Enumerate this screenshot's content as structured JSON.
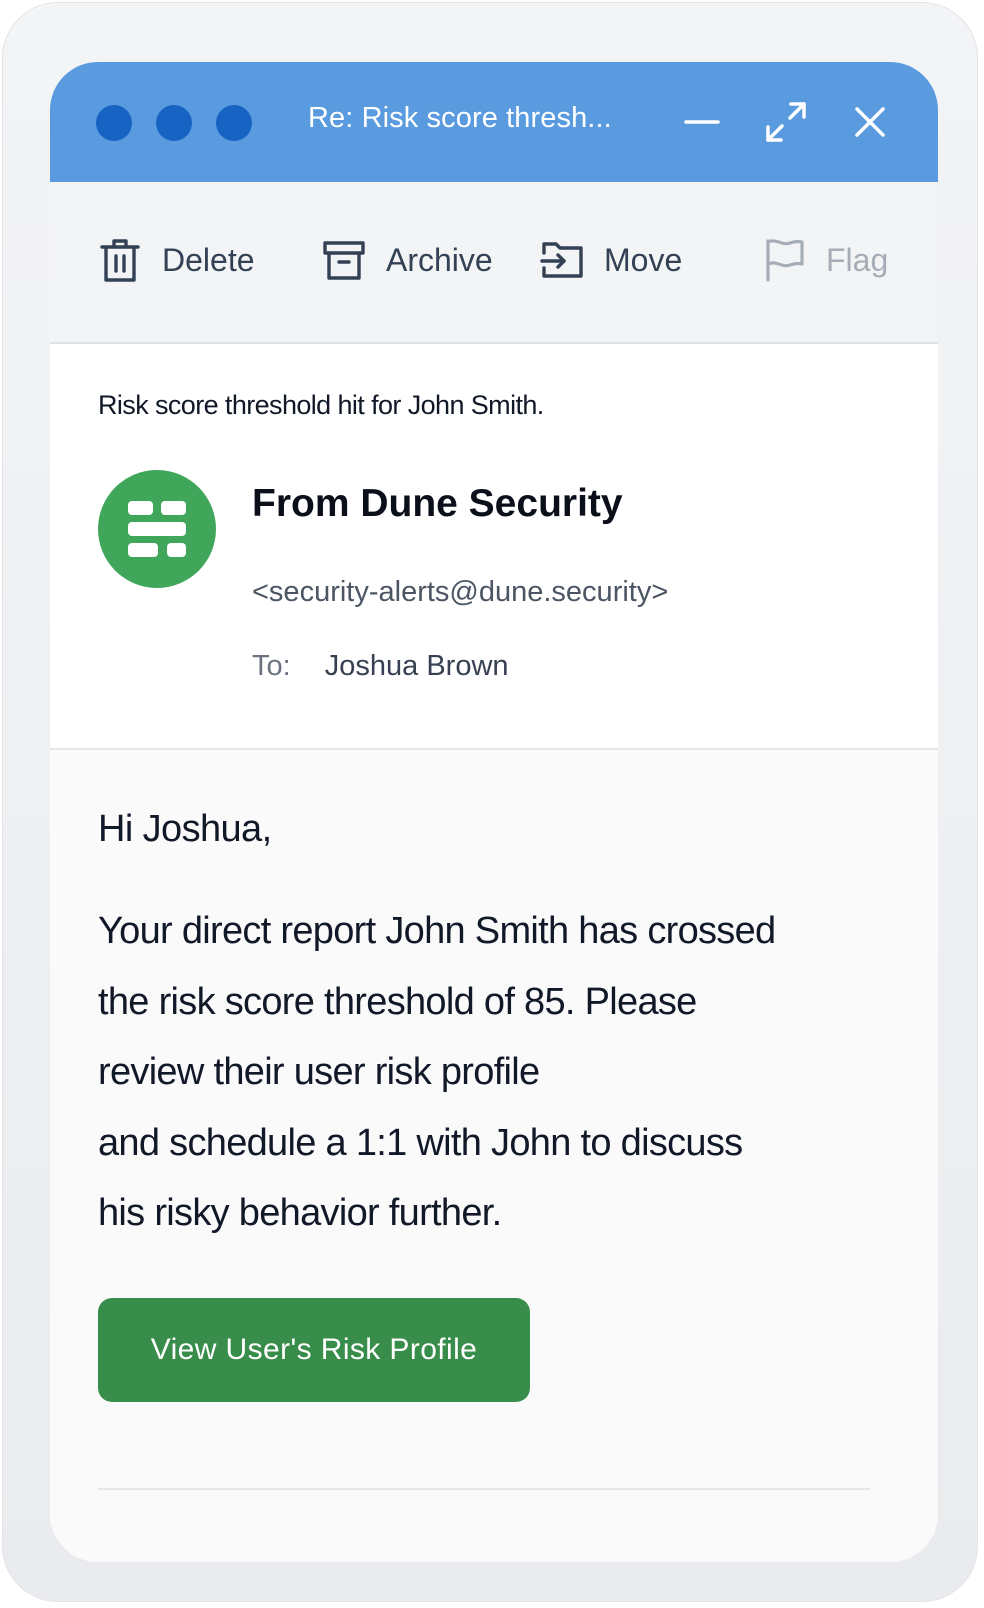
{
  "window": {
    "title": "Re: Risk score thresh...",
    "controls": [
      "minimize-icon",
      "maximize-icon",
      "close-icon"
    ],
    "accent_color": "#5a9be0",
    "traffic_light_color": "#1763c3"
  },
  "toolbar": {
    "delete_label": "Delete",
    "archive_label": "Archive",
    "move_label": "Move",
    "flag_label": "Flag",
    "icons": [
      "trash-icon",
      "archive-icon",
      "move-icon",
      "flag-icon"
    ]
  },
  "email": {
    "subject": "Risk score threshold hit for John Smith.",
    "sender_name": "From Dune Security",
    "sender_email": "<security-alerts@dune.security>",
    "to_label": "To:",
    "to_name": "Joshua Brown",
    "avatar_color": "#3fa65a"
  },
  "body": {
    "greeting": "Hi Joshua,",
    "lines": [
      "Your direct report John Smith has crossed",
      "the risk score threshold of 85. Please",
      "review their user risk profile",
      "and schedule a 1:1 with John to discuss",
      "his risky behavior further."
    ],
    "cta_label": "View User's Risk Profile",
    "cta_color": "#398d4a"
  }
}
